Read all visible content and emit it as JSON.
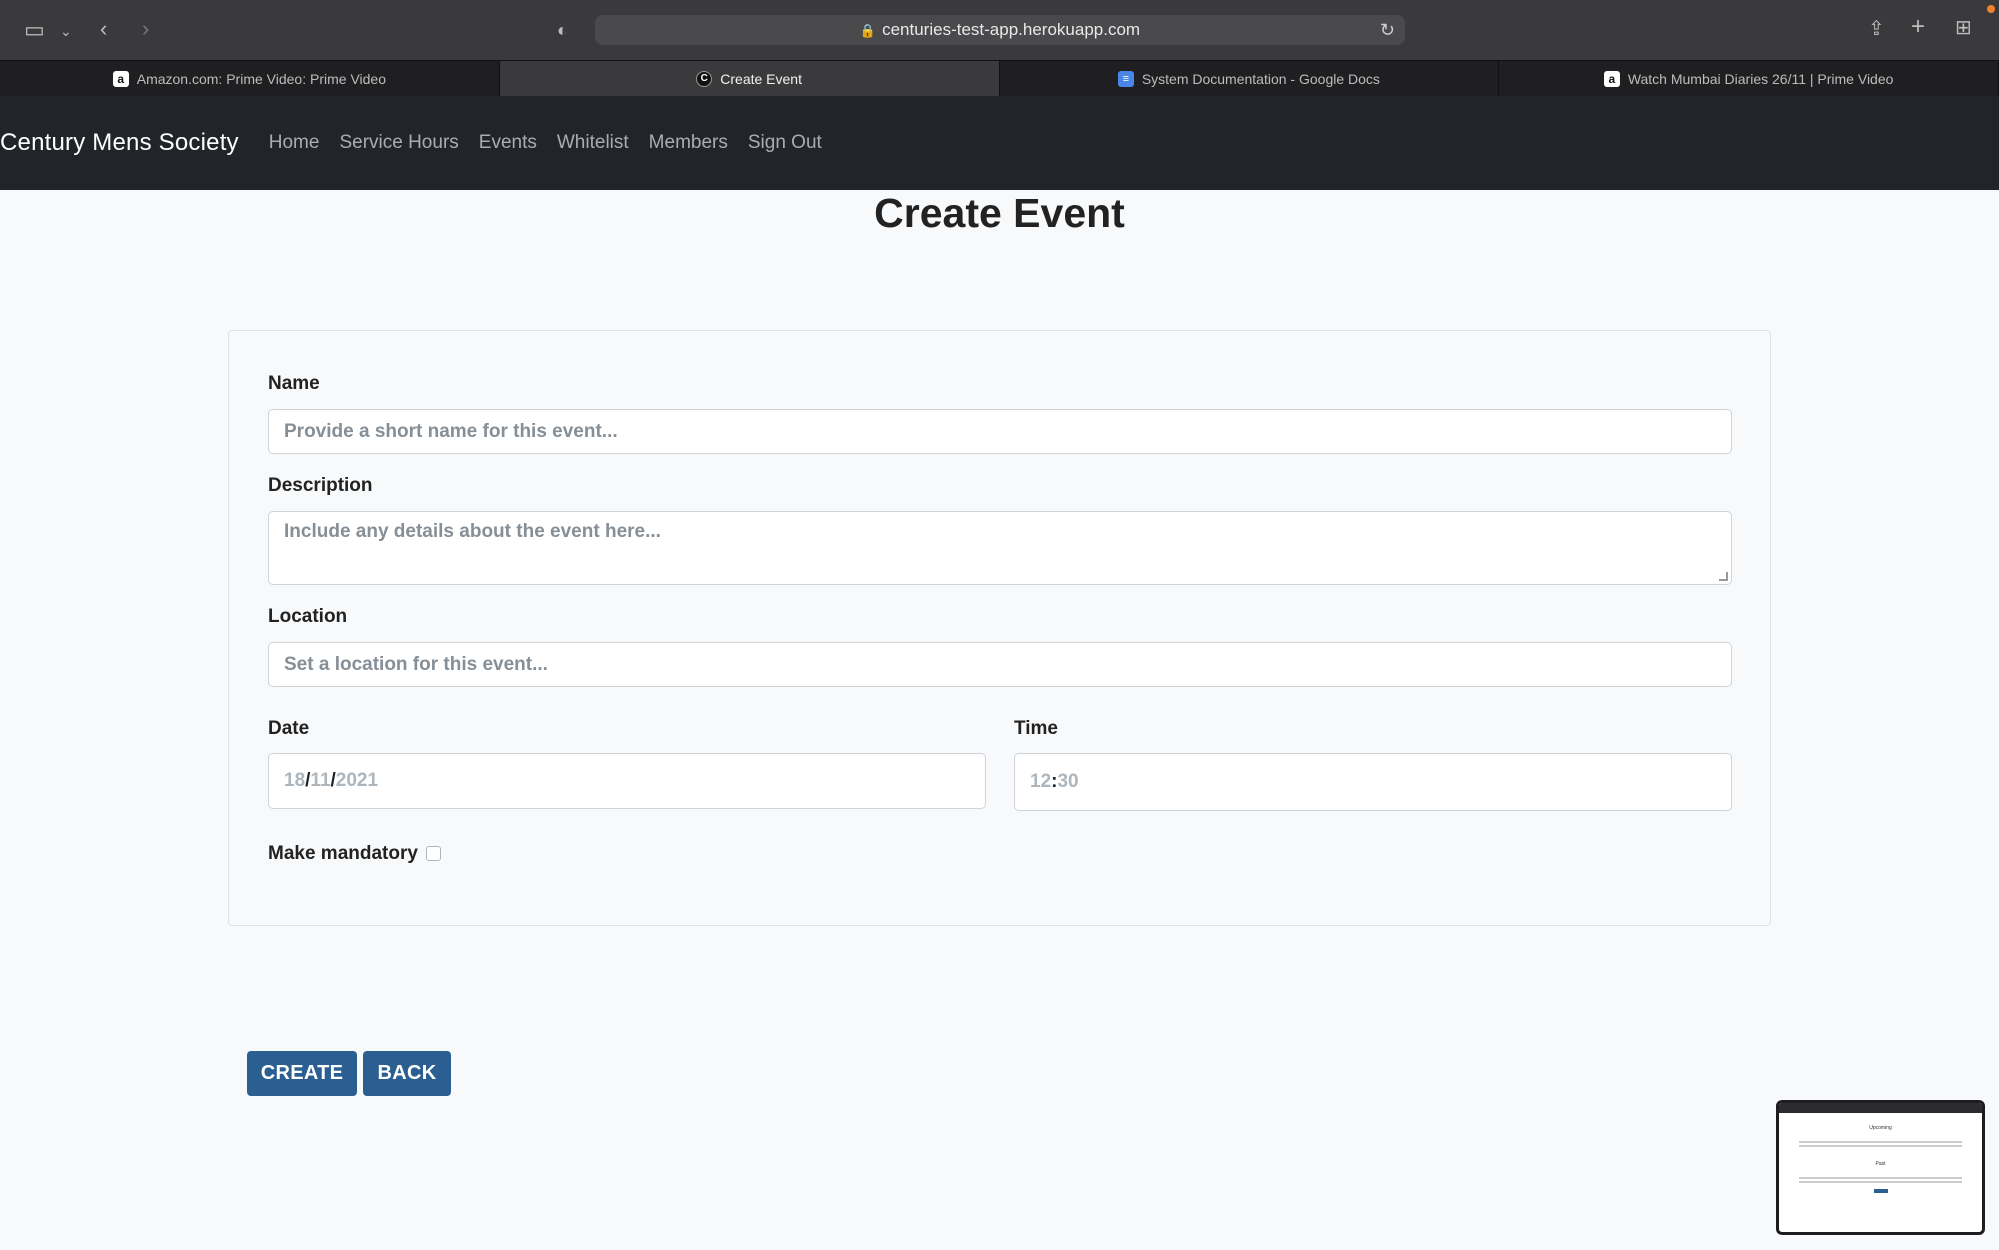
{
  "browser": {
    "url": "centuries-test-app.herokuapp.com",
    "tabs": [
      {
        "title": "Amazon.com: Prime Video: Prime Video",
        "icon": "amazon-icon",
        "active": false
      },
      {
        "title": "Create Event",
        "icon": "century-icon",
        "active": true
      },
      {
        "title": "System Documentation - Google Docs",
        "icon": "google-docs-icon",
        "active": false
      },
      {
        "title": "Watch Mumbai Diaries 26/11 | Prime Video",
        "icon": "amazon-icon",
        "active": false
      }
    ]
  },
  "navbar": {
    "brand": "Century Mens Society",
    "links": [
      "Home",
      "Service Hours",
      "Events",
      "Whitelist",
      "Members",
      "Sign Out"
    ]
  },
  "page": {
    "title": "Create Event"
  },
  "form": {
    "name_label": "Name",
    "name_placeholder": "Provide a short name for this event...",
    "description_label": "Description",
    "description_placeholder": "Include any details about the event here...",
    "location_label": "Location",
    "location_placeholder": "Set a location for this event...",
    "date_label": "Date",
    "date_day": "18",
    "date_month": "11",
    "date_year": "2021",
    "date_sep": "/",
    "time_label": "Time",
    "time_hour": "12",
    "time_minute": "30",
    "time_sep": ":",
    "mandatory_label": "Make mandatory"
  },
  "actions": {
    "create_label": "CREATE",
    "back_label": "BACK"
  },
  "thumbnail": {
    "upcoming": "Upcoming",
    "past": "Past"
  },
  "colors": {
    "navbar_bg": "#212529",
    "button_bg": "#2b5f92",
    "page_bg": "#f8f9fa"
  }
}
